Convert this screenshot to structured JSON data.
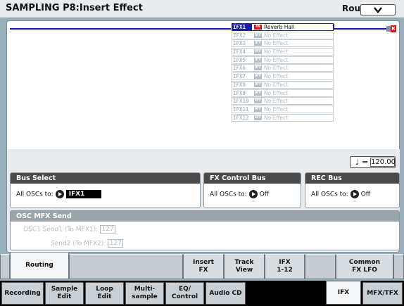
{
  "title": "SAMPLING P8:Insert Effect",
  "page_menu_label": "Routing",
  "routing": {
    "ifx_slots": [
      {
        "label": "IFX1",
        "switch": "ON",
        "effect": "Reverb Hall",
        "active": true
      },
      {
        "label": "IFX2",
        "switch": "OFF",
        "effect": "No Effect",
        "active": false
      },
      {
        "label": "IFX3",
        "switch": "OFF",
        "effect": "No Effect",
        "active": false
      },
      {
        "label": "IFX4",
        "switch": "OFF",
        "effect": "No Effect",
        "active": false
      },
      {
        "label": "IFX5",
        "switch": "OFF",
        "effect": "No Effect",
        "active": false
      },
      {
        "label": "IFX6",
        "switch": "OFF",
        "effect": "No Effect",
        "active": false
      },
      {
        "label": "IFX7",
        "switch": "OFF",
        "effect": "No Effect",
        "active": false
      },
      {
        "label": "IFX8",
        "switch": "OFF",
        "effect": "No Effect",
        "active": false
      },
      {
        "label": "IFX9",
        "switch": "OFF",
        "effect": "No Effect",
        "active": false
      },
      {
        "label": "IFX10",
        "switch": "OFF",
        "effect": "No Effect",
        "active": false
      },
      {
        "label": "IFX11",
        "switch": "OFF",
        "effect": "No Effect",
        "active": false
      },
      {
        "label": "IFX12",
        "switch": "OFF",
        "effect": "No Effect",
        "active": false
      }
    ],
    "output_label": "R"
  },
  "tempo": {
    "symbol": "♩",
    "equals": "=",
    "value": "120.00"
  },
  "bus_select": {
    "header": "Bus Select",
    "label": "All OSCs to:",
    "value": "IFX1"
  },
  "fx_control_bus": {
    "header": "FX Control Bus",
    "label": "All OSCs to:",
    "value": "Off"
  },
  "rec_bus": {
    "header": "REC Bus",
    "label": "All OSCs to:",
    "value": "Off"
  },
  "osc_mfx_send": {
    "header": "OSC MFX Send",
    "send1_label": "OSC1 Send1 (To MFX1):",
    "send1_value": "127",
    "send2_label": "Send2 (To MFX2):",
    "send2_value": "127"
  },
  "sub_tabs": {
    "routing": "Routing",
    "insert_fx": [
      "Insert",
      "FX"
    ],
    "track_view": [
      "Track",
      "View"
    ],
    "ifx_1_12": [
      "IFX",
      "1-12"
    ],
    "common_fx_lfo": [
      "Common",
      "FX LFO"
    ]
  },
  "main_tabs": {
    "recording": "Recording",
    "sample_edit": [
      "Sample",
      "Edit"
    ],
    "loop_edit": [
      "Loop",
      "Edit"
    ],
    "multisample": [
      "Multi-",
      "sample"
    ],
    "eq_control": [
      "EQ/",
      "Control"
    ],
    "audio_cd": "Audio CD",
    "ifx": "IFX",
    "mfx_tfx": "MFX/TFX"
  }
}
